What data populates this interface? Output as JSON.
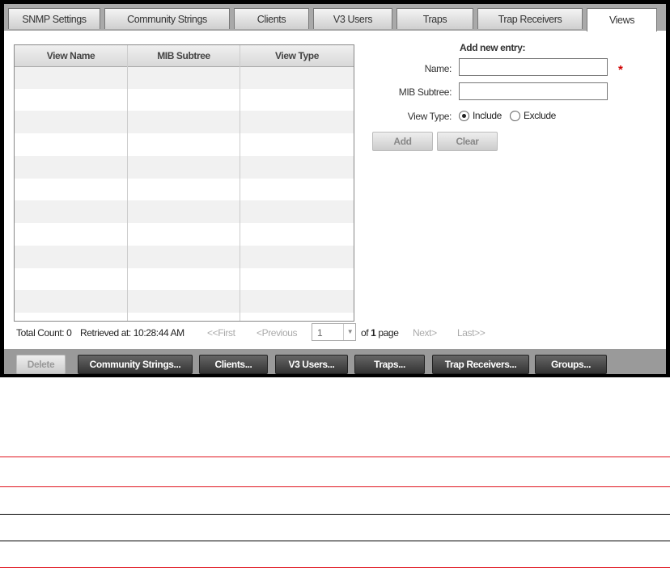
{
  "tabs": [
    {
      "label": "SNMP Settings"
    },
    {
      "label": "Community Strings"
    },
    {
      "label": "Clients"
    },
    {
      "label": "V3 Users"
    },
    {
      "label": "Traps"
    },
    {
      "label": "Trap Receivers"
    },
    {
      "label": "Views",
      "active": true
    }
  ],
  "table": {
    "columns": [
      "View Name",
      "MIB Subtree",
      "View Type"
    ],
    "rows": []
  },
  "form": {
    "title": "Add new entry:",
    "name_label": "Name:",
    "name_value": "",
    "required_mark": "*",
    "mib_label": "MIB Subtree:",
    "mib_value": "",
    "view_type_label": "View Type:",
    "options": [
      "Include",
      "Exclude"
    ],
    "selected": "Include",
    "add_label": "Add",
    "clear_label": "Clear"
  },
  "status": {
    "total": "Total Count: 0",
    "retrieved": "Retrieved at: 10:28:44 AM"
  },
  "pagination": {
    "first": "<<First",
    "previous": "<Previous",
    "page": "1",
    "of_prefix": "of ",
    "total_pages": "1",
    "of_suffix": " page",
    "next": "Next>",
    "last": "Last>>"
  },
  "actions": [
    "Delete",
    "Community Strings...",
    "Clients...",
    "V3 Users...",
    "Traps...",
    "Trap Receivers...",
    "Groups..."
  ],
  "colors": {
    "required": "#d00000",
    "rule_red": "#e0141e"
  }
}
